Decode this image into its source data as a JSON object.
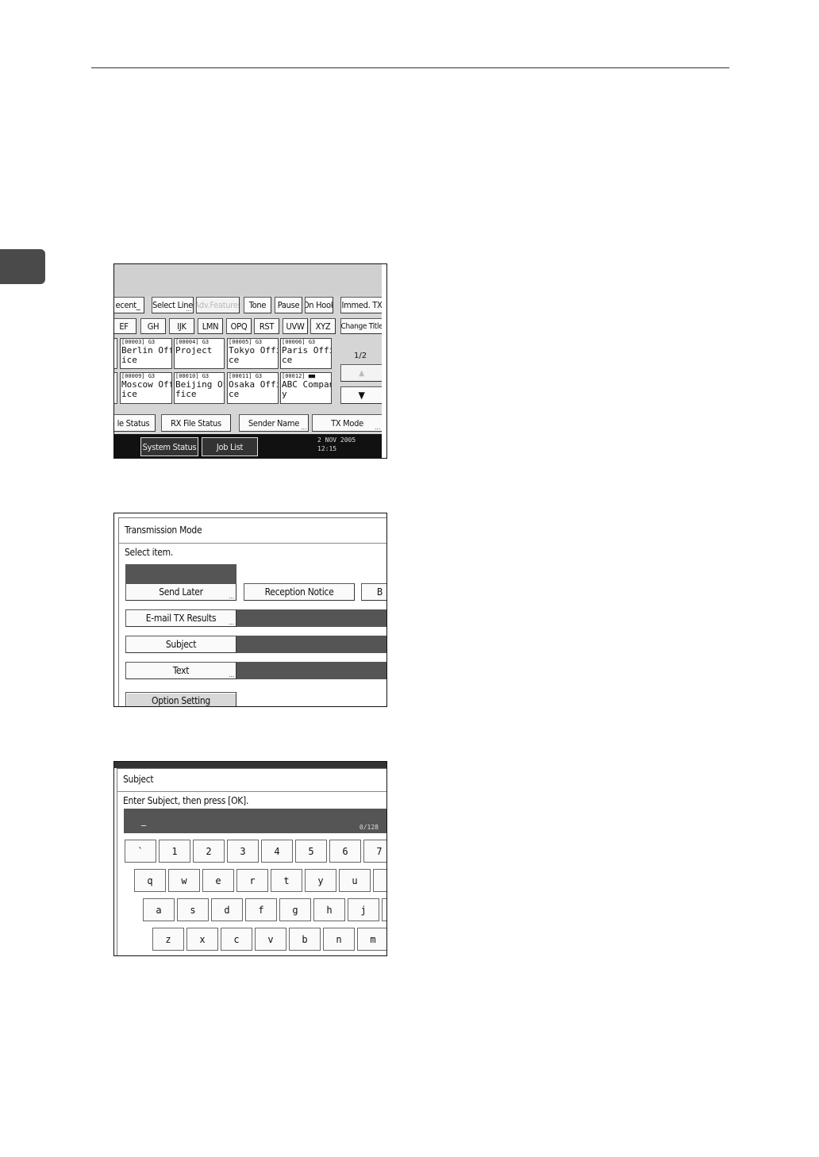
{
  "screen1": {
    "toolbar": [
      "ecent_",
      "Select Line",
      "Adv.Features",
      "Tone",
      "Pause",
      "On Hook",
      "Immed. TX"
    ],
    "index_tabs": [
      "EF",
      "GH",
      "IJK",
      "LMN",
      "OPQ",
      "RST",
      "UVW",
      "XYZ"
    ],
    "change_title": "Change Title",
    "destinations": [
      {
        "tag": "[00003] G3",
        "name1": "Berlin Off",
        "name2": "ice"
      },
      {
        "tag": "[00004] G3",
        "name1": "Project",
        "name2": ""
      },
      {
        "tag": "[00005] G3",
        "name1": "Tokyo Offi",
        "name2": "ce"
      },
      {
        "tag": "[00006] G3",
        "name1": "Paris Offi",
        "name2": "ce"
      },
      {
        "tag": "[00009] G3",
        "name1": "Moscow Off",
        "name2": "ice"
      },
      {
        "tag": "[00010] G3",
        "name1": "Beijing Of",
        "name2": "fice"
      },
      {
        "tag": "[00011] G3",
        "name1": "Osaka Offi",
        "name2": "ce"
      },
      {
        "tag": "[00012] ■■",
        "name1": "ABC Compan",
        "name2": "y"
      }
    ],
    "page_indicator": "1/2",
    "scroll_up": "▲",
    "scroll_down": "▼",
    "bottom_buttons": [
      "le Status",
      "RX File Status",
      "Sender Name",
      "TX Mode"
    ],
    "status_buttons": [
      "System Status",
      "Job List"
    ],
    "date": "2 NOV  2005",
    "time": "12:15"
  },
  "screen2": {
    "title": "Transmission Mode",
    "prompt": "Select item.",
    "send_later": "Send Later",
    "reception_notice": "Reception Notice",
    "cut_button": "B",
    "email_tx_results": "E-mail TX Results",
    "subject": "Subject",
    "text": "Text",
    "option_setting": "Option Setting"
  },
  "screen3": {
    "title": "Subject",
    "prompt": "Enter Subject, then press [OK].",
    "cursor": "_",
    "counter": "0/128",
    "row1": [
      "`",
      "1",
      "2",
      "3",
      "4",
      "5",
      "6",
      "7"
    ],
    "row2": [
      "q",
      "w",
      "e",
      "r",
      "t",
      "y",
      "u",
      ""
    ],
    "row3": [
      "a",
      "s",
      "d",
      "f",
      "g",
      "h",
      "j",
      ""
    ],
    "row4": [
      "z",
      "x",
      "c",
      "v",
      "b",
      "n",
      "m"
    ]
  }
}
